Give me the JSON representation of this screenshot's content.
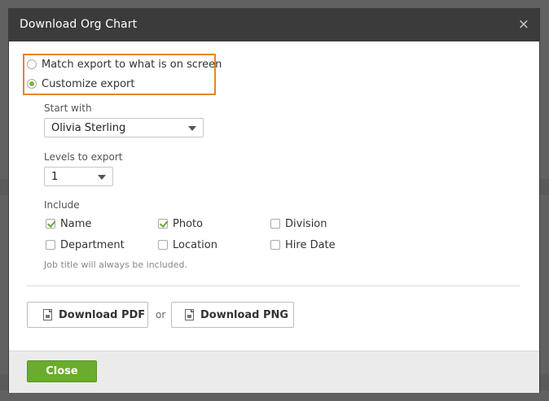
{
  "dialog": {
    "title": "Download Org Chart",
    "close_glyph": "×"
  },
  "export_mode": {
    "options": [
      {
        "label": "Match export to what is on screen",
        "selected": false
      },
      {
        "label": "Customize export",
        "selected": true
      }
    ],
    "highlight_color": "#e8852a"
  },
  "start_with": {
    "label": "Start with",
    "value": "Olivia Sterling"
  },
  "levels": {
    "label": "Levels to export",
    "value": "1"
  },
  "include": {
    "label": "Include",
    "items": [
      {
        "label": "Name",
        "checked": true
      },
      {
        "label": "Photo",
        "checked": true
      },
      {
        "label": "Division",
        "checked": false
      },
      {
        "label": "Department",
        "checked": false
      },
      {
        "label": "Location",
        "checked": false
      },
      {
        "label": "Hire Date",
        "checked": false
      }
    ],
    "note": "Job title will always be included."
  },
  "downloads": {
    "pdf_label": "Download PDF",
    "or_text": "or",
    "png_label": "Download PNG",
    "pdf_icon": "pdf-file-icon",
    "png_icon": "image-file-icon"
  },
  "footer": {
    "close_label": "Close",
    "close_color": "#6aac2e"
  }
}
